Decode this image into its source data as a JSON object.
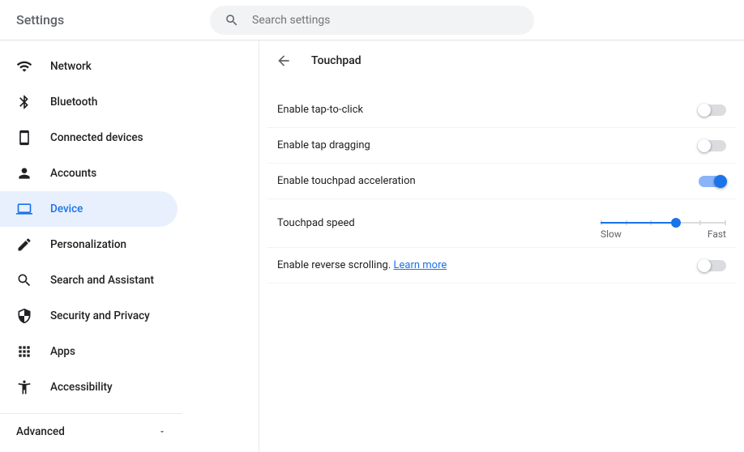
{
  "header": {
    "title": "Settings",
    "search_placeholder": "Search settings"
  },
  "sidebar": {
    "items": [
      {
        "label": "Network",
        "icon": "wifi"
      },
      {
        "label": "Bluetooth",
        "icon": "bluetooth"
      },
      {
        "label": "Connected devices",
        "icon": "device"
      },
      {
        "label": "Accounts",
        "icon": "person"
      },
      {
        "label": "Device",
        "icon": "laptop",
        "active": true
      },
      {
        "label": "Personalization",
        "icon": "edit"
      },
      {
        "label": "Search and Assistant",
        "icon": "search"
      },
      {
        "label": "Security and Privacy",
        "icon": "shield"
      },
      {
        "label": "Apps",
        "icon": "apps"
      },
      {
        "label": "Accessibility",
        "icon": "accessibility"
      }
    ],
    "advanced_label": "Advanced"
  },
  "main": {
    "page_title": "Touchpad",
    "settings": [
      {
        "label": "Enable tap-to-click",
        "enabled": false
      },
      {
        "label": "Enable tap dragging",
        "enabled": false
      },
      {
        "label": "Enable touchpad acceleration",
        "enabled": true
      }
    ],
    "speed": {
      "label": "Touchpad speed",
      "slow_label": "Slow",
      "fast_label": "Fast",
      "value": 3,
      "max": 5
    },
    "reverse_scroll": {
      "label": "Enable reverse scrolling. ",
      "link_text": "Learn more",
      "enabled": false
    }
  }
}
